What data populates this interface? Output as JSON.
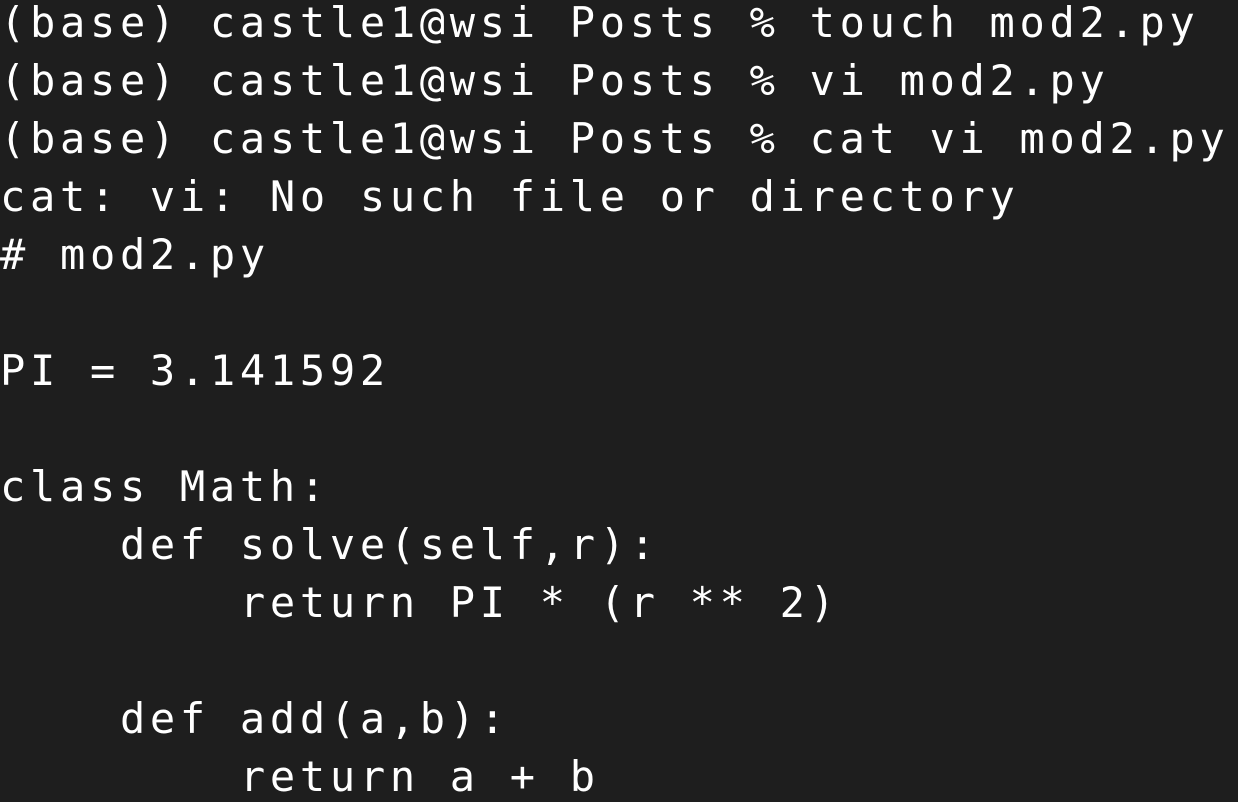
{
  "terminal": {
    "background_color": "#1e1e1e",
    "text_color": "#ffffff",
    "lines": [
      "(base) castle1@wsi Posts % touch mod2.py",
      "(base) castle1@wsi Posts % vi mod2.py",
      "(base) castle1@wsi Posts % cat vi mod2.py",
      "cat: vi: No such file or directory",
      "# mod2.py",
      "",
      "PI = 3.141592",
      "",
      "class Math:",
      "    def solve(self,r):",
      "        return PI * (r ** 2)",
      "",
      "    def add(a,b):",
      "        return a + b"
    ]
  }
}
